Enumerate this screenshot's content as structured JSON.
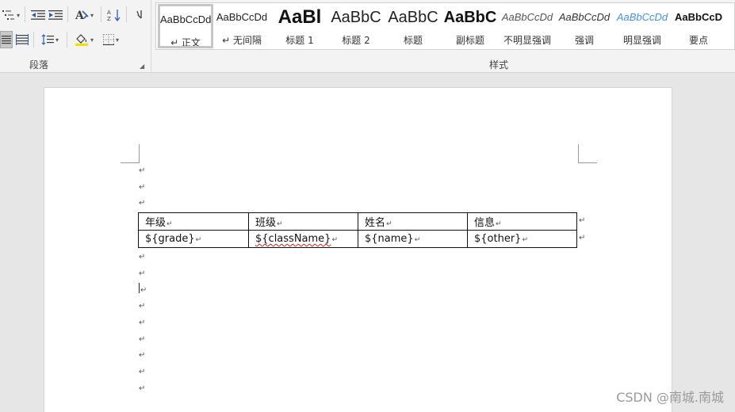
{
  "ribbon": {
    "paragraph_group_label": "段落",
    "styles_group_label": "样式",
    "styles": [
      {
        "preview": "AaBbCcDd",
        "name": "正文",
        "mark": "↵",
        "selected": true
      },
      {
        "preview": "AaBbCcDd",
        "name": "无间隔",
        "mark": "↵",
        "selected": false
      },
      {
        "preview": "AaBl",
        "name": "标题 1",
        "mark": "",
        "selected": false
      },
      {
        "preview": "AaBbC",
        "name": "标题 2",
        "mark": "",
        "selected": false
      },
      {
        "preview": "AaBbC",
        "name": "标题",
        "mark": "",
        "selected": false
      },
      {
        "preview": "AaBbC",
        "name": "副标题",
        "mark": "",
        "selected": false
      },
      {
        "preview": "AaBbCcDd",
        "name": "不明显强调",
        "mark": "",
        "selected": false
      },
      {
        "preview": "AaBbCcDd",
        "name": "强调",
        "mark": "",
        "selected": false
      },
      {
        "preview": "AaBbCcDd",
        "name": "明显强调",
        "mark": "",
        "selected": false
      },
      {
        "preview": "AaBbCcD",
        "name": "要点",
        "mark": "",
        "selected": false
      }
    ]
  },
  "document": {
    "paragraph_mark": "↵",
    "table": {
      "header": [
        "年级",
        "班级",
        "姓名",
        "信息"
      ],
      "row": [
        "${grade}",
        "${className}",
        "${name}",
        "${other}"
      ]
    }
  },
  "watermark": "CSDN @南城.南城",
  "colors": {
    "ribbon_bg": "#f3f3f3",
    "canvas_bg": "#e6e6e6",
    "spell_error": "#d21f1f",
    "accent_blue": "#2f5fb3"
  }
}
